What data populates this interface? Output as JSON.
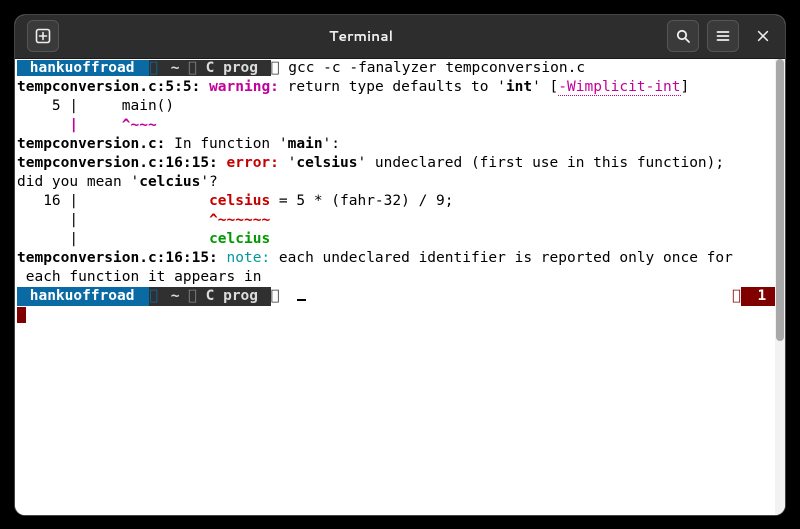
{
  "window": {
    "title": "Terminal"
  },
  "prompt": {
    "user": "hankuoffroad",
    "home": "~",
    "dir": "C prog"
  },
  "cmd1": "gcc -c -fanalyzer tempconversion.c",
  "out": {
    "l1a": "tempconversion.c:5:5: ",
    "l1_warn": "warning: ",
    "l1b": "return type defaults to '",
    "l1_int": "int",
    "l1c": "' [",
    "l1_flag": "-Wimplicit-int",
    "l1d": "]",
    "l2": "    5 |     main()",
    "l3": "      |     ^~~~",
    "l4a": "tempconversion.c:",
    "l4b": " In function '",
    "l4_main": "main",
    "l4c": "':",
    "l5a": "tempconversion.c:16:15: ",
    "l5_err": "error: ",
    "l5b": "'",
    "l5_id": "celsius",
    "l5c": "' undeclared (first use in this function);",
    "l6": "did you mean '",
    "l6_fix": "celcius",
    "l6b": "'?",
    "l7a": "   16 |               ",
    "l7_id": "celsius",
    "l7b": " = 5 * (fahr-32) / 9;",
    "l8a": "      |               ",
    "l8b": "^~~~~~~",
    "l9a": "      |               ",
    "l9b": "celcius",
    "l10a": "tempconversion.c:16:15: ",
    "l10_note": "note: ",
    "l10b": "each undeclared identifier is reported only once for",
    "l11": " each function it appears in"
  },
  "status": {
    "error_count": "1"
  }
}
